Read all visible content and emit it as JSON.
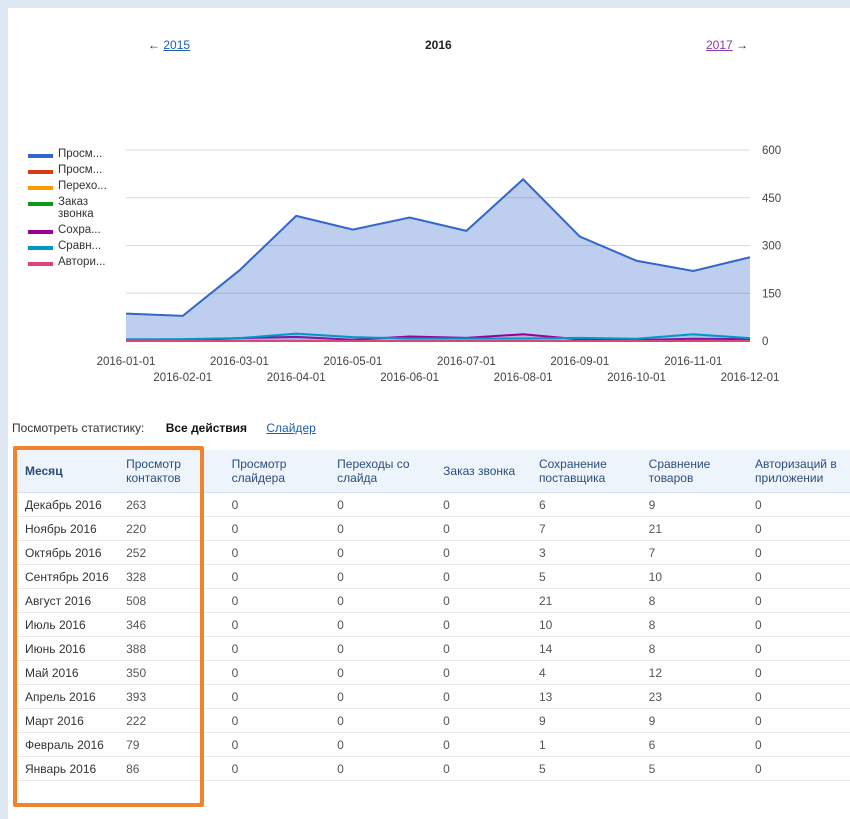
{
  "year_nav": {
    "prev": "2015",
    "current": "2016",
    "next": "2017",
    "prev_arrow": "←",
    "next_arrow": "→"
  },
  "chart_data": {
    "type": "area",
    "x": [
      "2016-01-01",
      "2016-02-01",
      "2016-03-01",
      "2016-04-01",
      "2016-05-01",
      "2016-06-01",
      "2016-07-01",
      "2016-08-01",
      "2016-09-01",
      "2016-10-01",
      "2016-11-01",
      "2016-12-01"
    ],
    "ylim": [
      0,
      600
    ],
    "yticks": [
      "600",
      "450",
      "300",
      "150",
      "0"
    ],
    "legend_position": "left",
    "series": [
      {
        "name": "Просм...",
        "color": "#3366cc",
        "values": [
          86,
          79,
          222,
          393,
          350,
          388,
          346,
          508,
          328,
          252,
          220,
          263
        ]
      },
      {
        "name": "Просм...",
        "color": "#dc3912",
        "values": [
          0,
          0,
          0,
          0,
          0,
          0,
          0,
          0,
          0,
          0,
          0,
          0
        ]
      },
      {
        "name": "Перехо...",
        "color": "#ff9900",
        "values": [
          0,
          0,
          0,
          0,
          0,
          0,
          0,
          0,
          0,
          0,
          0,
          0
        ]
      },
      {
        "name": "Заказ звонка",
        "color": "#109618",
        "values": [
          0,
          0,
          0,
          0,
          0,
          0,
          0,
          0,
          0,
          0,
          0,
          0
        ]
      },
      {
        "name": "Сохра...",
        "color": "#990099",
        "values": [
          5,
          1,
          9,
          13,
          4,
          14,
          10,
          21,
          5,
          3,
          7,
          6
        ]
      },
      {
        "name": "Сравн...",
        "color": "#0099c6",
        "values": [
          5,
          6,
          9,
          23,
          12,
          8,
          8,
          8,
          10,
          7,
          21,
          9
        ]
      },
      {
        "name": "Автори...",
        "color": "#dd4477",
        "values": [
          0,
          0,
          0,
          0,
          0,
          0,
          0,
          0,
          0,
          0,
          0,
          0
        ]
      }
    ]
  },
  "stats_bar": {
    "label": "Посмотреть статистику:",
    "active": "Все действия",
    "link": "Слайдер"
  },
  "table": {
    "headers": [
      "Месяц",
      "Просмотр контактов",
      "Просмотр слайдера",
      "Переходы со слайда",
      "Заказ звонка",
      "Сохранение поставщика",
      "Сравнение товаров",
      "Авторизаций в приложении"
    ],
    "rows": [
      [
        "Декабрь 2016",
        "263",
        "0",
        "0",
        "0",
        "6",
        "9",
        "0"
      ],
      [
        "Ноябрь 2016",
        "220",
        "0",
        "0",
        "0",
        "7",
        "21",
        "0"
      ],
      [
        "Октябрь 2016",
        "252",
        "0",
        "0",
        "0",
        "3",
        "7",
        "0"
      ],
      [
        "Сентябрь 2016",
        "328",
        "0",
        "0",
        "0",
        "5",
        "10",
        "0"
      ],
      [
        "Август 2016",
        "508",
        "0",
        "0",
        "0",
        "21",
        "8",
        "0"
      ],
      [
        "Июль 2016",
        "346",
        "0",
        "0",
        "0",
        "10",
        "8",
        "0"
      ],
      [
        "Июнь 2016",
        "388",
        "0",
        "0",
        "0",
        "14",
        "8",
        "0"
      ],
      [
        "Май 2016",
        "350",
        "0",
        "0",
        "0",
        "4",
        "12",
        "0"
      ],
      [
        "Апрель 2016",
        "393",
        "0",
        "0",
        "0",
        "13",
        "23",
        "0"
      ],
      [
        "Март 2016",
        "222",
        "0",
        "0",
        "0",
        "9",
        "9",
        "0"
      ],
      [
        "Февраль 2016",
        "79",
        "0",
        "0",
        "0",
        "1",
        "6",
        "0"
      ],
      [
        "Январь 2016",
        "86",
        "0",
        "0",
        "0",
        "5",
        "5",
        "0"
      ]
    ]
  }
}
